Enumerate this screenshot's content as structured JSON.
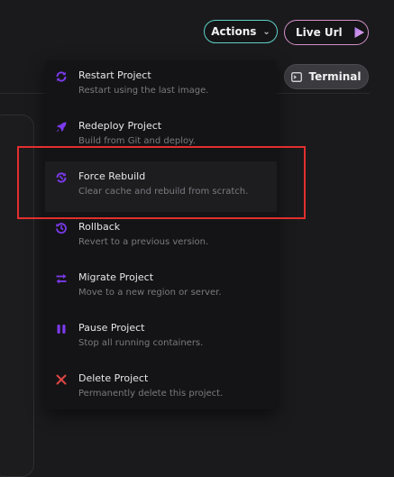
{
  "header": {
    "actions_label": "Actions",
    "live_url_label": "Live Url",
    "terminal_label": "Terminal"
  },
  "menu": {
    "items": [
      {
        "title": "Restart Project",
        "desc": "Restart using the last image.",
        "icon": "restart-icon"
      },
      {
        "title": "Redeploy Project",
        "desc": "Build from Git and deploy.",
        "icon": "rocket-icon"
      },
      {
        "title": "Force Rebuild",
        "desc": "Clear cache and rebuild from scratch.",
        "icon": "force-rebuild-icon"
      },
      {
        "title": "Rollback",
        "desc": "Revert to a previous version.",
        "icon": "history-icon"
      },
      {
        "title": "Migrate Project",
        "desc": "Move to a new region or server.",
        "icon": "swap-arrows-icon"
      },
      {
        "title": "Pause Project",
        "desc": "Stop all running containers.",
        "icon": "pause-icon"
      },
      {
        "title": "Delete Project",
        "desc": "Permanently delete this project.",
        "icon": "x-icon"
      }
    ],
    "highlighted_index": 2
  },
  "colors": {
    "accent_purple": "#7c3aed",
    "delete_red": "#e04545",
    "annotation_red": "#e32e2e"
  }
}
